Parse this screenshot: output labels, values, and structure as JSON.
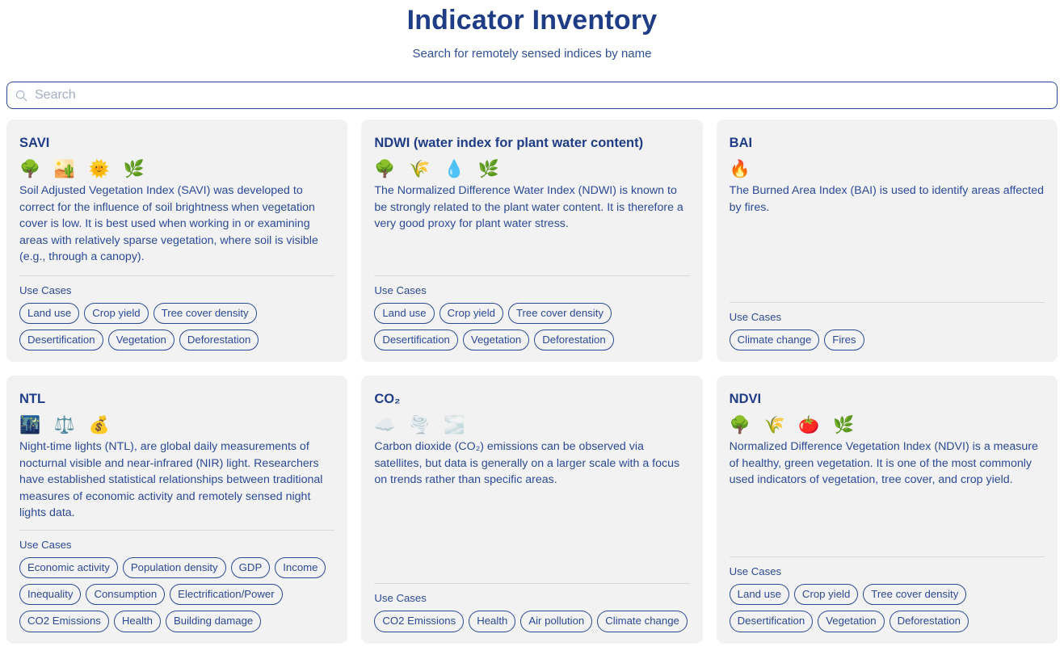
{
  "header": {
    "title": "Indicator Inventory",
    "subtitle": "Search for remotely sensed indices by name"
  },
  "search": {
    "placeholder": "Search",
    "value": "",
    "icon": "search-icon"
  },
  "labels": {
    "use_cases": "Use Cases"
  },
  "colors": {
    "title": "#1f3d86",
    "text": "#2b4a96",
    "card_bg": "#f2f2f3",
    "divider": "#d9d9dc",
    "page_bg": "#ffffff"
  },
  "cards": [
    {
      "title": "SAVI",
      "emojis": [
        "🌳",
        "🏜️",
        "🌞",
        "🌿"
      ],
      "emoji_names": [
        "deciduous-tree-icon",
        "desert-icon",
        "sun-with-face-icon",
        "herb-icon"
      ],
      "description": "Soil Adjusted Vegetation Index (SAVI) was developed to correct for the influence of soil brightness when vegetation cover is low. It is best used when working in or examining areas with relatively sparse vegetation, where soil is visible (e.g., through a canopy).",
      "use_cases": [
        "Land use",
        "Crop yield",
        "Tree cover density",
        "Desertification",
        "Vegetation",
        "Deforestation"
      ]
    },
    {
      "title": "NDWI (water index for plant water content)",
      "emojis": [
        "🌳",
        "🌾",
        "💧",
        "🌿"
      ],
      "emoji_names": [
        "deciduous-tree-icon",
        "sheaf-of-rice-icon",
        "droplet-icon",
        "herb-icon"
      ],
      "description": "The Normalized Difference Water Index (NDWI) is known to be strongly related to the plant water content. It is therefore a very good proxy for plant water stress.",
      "use_cases": [
        "Land use",
        "Crop yield",
        "Tree cover density",
        "Desertification",
        "Vegetation",
        "Deforestation"
      ]
    },
    {
      "title": "BAI",
      "emojis": [
        "🔥"
      ],
      "emoji_names": [
        "fire-icon"
      ],
      "description": "The Burned Area Index (BAI) is used to identify areas affected by fires.",
      "use_cases": [
        "Climate change",
        "Fires"
      ]
    },
    {
      "title": "NTL",
      "emojis": [
        "🌃",
        "⚖️",
        "💰"
      ],
      "emoji_names": [
        "night-with-stars-icon",
        "balance-scale-icon",
        "money-bag-icon"
      ],
      "description": "Night-time lights (NTL), are global daily measurements of nocturnal visible and near-infrared (NIR) light. Researchers have established statistical relationships between traditional measures of economic activity and remotely sensed night lights data.",
      "use_cases": [
        "Economic activity",
        "Population density",
        "GDP",
        "Income",
        "Inequality",
        "Consumption",
        "Electrification/Power",
        "CO2 Emissions",
        "Health",
        "Building damage"
      ]
    },
    {
      "title": "CO₂",
      "emojis": [
        "☁️",
        "🌪️",
        "🌫️"
      ],
      "emoji_names": [
        "cloud-icon",
        "tornado-icon",
        "fog-icon"
      ],
      "description": "Carbon dioxide (CO₂) emissions can be observed via satellites, but data is generally on a larger scale with a focus on trends rather than specific areas.",
      "use_cases": [
        "CO2 Emissions",
        "Health",
        "Air pollution",
        "Climate change"
      ]
    },
    {
      "title": "NDVI",
      "emojis": [
        "🌳",
        "🌾",
        "🍅",
        "🌿"
      ],
      "emoji_names": [
        "deciduous-tree-icon",
        "sheaf-of-rice-icon",
        "tomato-icon",
        "herb-icon"
      ],
      "description": "Normalized Difference Vegetation Index (NDVI) is a measure of healthy, green vegetation. It is one of the most commonly used indicators of vegetation, tree cover, and crop yield.",
      "use_cases": [
        "Land use",
        "Crop yield",
        "Tree cover density",
        "Desertification",
        "Vegetation",
        "Deforestation"
      ]
    }
  ]
}
